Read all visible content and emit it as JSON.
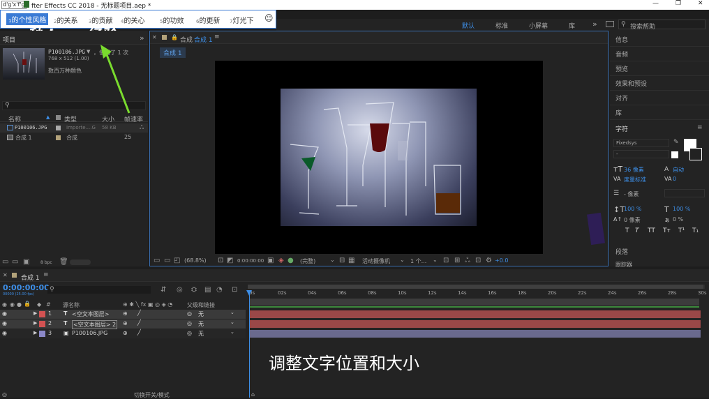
{
  "titlebar": {
    "ctrl": "d'g'x'f'g",
    "title": "fter Effects CC 2018 - 无标题项目.aep *",
    "min": "—",
    "max": "❐",
    "close": "✕"
  },
  "toolbar": {
    "items": [
      {
        "n": "1",
        "label": "的个性风格"
      },
      {
        "n": "2",
        "label": "的关系"
      },
      {
        "n": "3",
        "label": "的贡献"
      },
      {
        "n": "4",
        "label": "的关心"
      },
      {
        "n": "5",
        "label": "的功效"
      },
      {
        "n": "6",
        "label": "的更新"
      },
      {
        "n": "7",
        "label": "灯光下"
      }
    ],
    "emoji": "☺"
  },
  "watermark": "秒dong经验",
  "workspaces": {
    "items": [
      "默认",
      "标准",
      "小屏幕",
      "库"
    ],
    "more": "»",
    "search": "搜索帮助"
  },
  "project": {
    "tab": "项目",
    "more": "»",
    "file": "P100106.JPG",
    "arrow": "▼",
    "used": "，使用了 1 次",
    "dims": "768 x 512 (1.00)",
    "colors": "数百万种颜色",
    "search_icon": "⚲",
    "cols": [
      "名称",
      "类型",
      "大小",
      "帧速率"
    ],
    "rows": [
      {
        "name": "P100106.JPG",
        "type": "Importe....G",
        "size": "58 KB",
        "fps": ""
      },
      {
        "name": "合成 1",
        "type": "合成",
        "size": "",
        "fps": "25"
      }
    ],
    "bpc": "8 bpc"
  },
  "comp": {
    "tab": "合成",
    "tab_name": "合成 1",
    "sub": "合成 1",
    "zoom": "(68.8%)",
    "time": "0:00:00:00",
    "quality": "(完整)",
    "camera": "活动摄像机",
    "views": "1 个...",
    "offset": "+0.0"
  },
  "right": {
    "items": [
      "信息",
      "音频",
      "预览",
      "效果和预设",
      "对齐",
      "库"
    ],
    "char_title": "字符",
    "font": "Fixedsys",
    "font_style": "-",
    "size": "36 像素",
    "leading": "自动",
    "kerning": "度量标准",
    "tracking": "0",
    "stroke_unit": "- 像素",
    "vscale": "100 %",
    "hscale": "100 %",
    "baseline": "0 像素",
    "tsume": "0 %",
    "styles": [
      "T",
      "T",
      "TT",
      "Tт",
      "T¹",
      "T₁"
    ],
    "para": "段落",
    "para2": "跟踪器"
  },
  "timeline": {
    "tab": "合成 1",
    "timecode": "0:00:00:00",
    "fps": "00000 (25.00 fps)",
    "search_icon": "⚲",
    "headers": [
      "源名称",
      "父级和链接"
    ],
    "layers": [
      {
        "n": "1",
        "name": "<空文本图层>",
        "parent": "无",
        "color": "#d35252"
      },
      {
        "n": "2",
        "name": "<空文本图层> 2",
        "parent": "无",
        "color": "#d35252"
      },
      {
        "n": "3",
        "name": "P100106.JPG",
        "parent": "无",
        "color": "#8b88c8"
      }
    ],
    "ruler": [
      "0s",
      "02s",
      "04s",
      "06s",
      "08s",
      "10s",
      "12s",
      "14s",
      "16s",
      "18s",
      "20s",
      "22s",
      "24s",
      "26s",
      "28s",
      "30s"
    ],
    "switch_label": "切换开关/模式"
  },
  "subtitle": "调整文字位置和大小"
}
